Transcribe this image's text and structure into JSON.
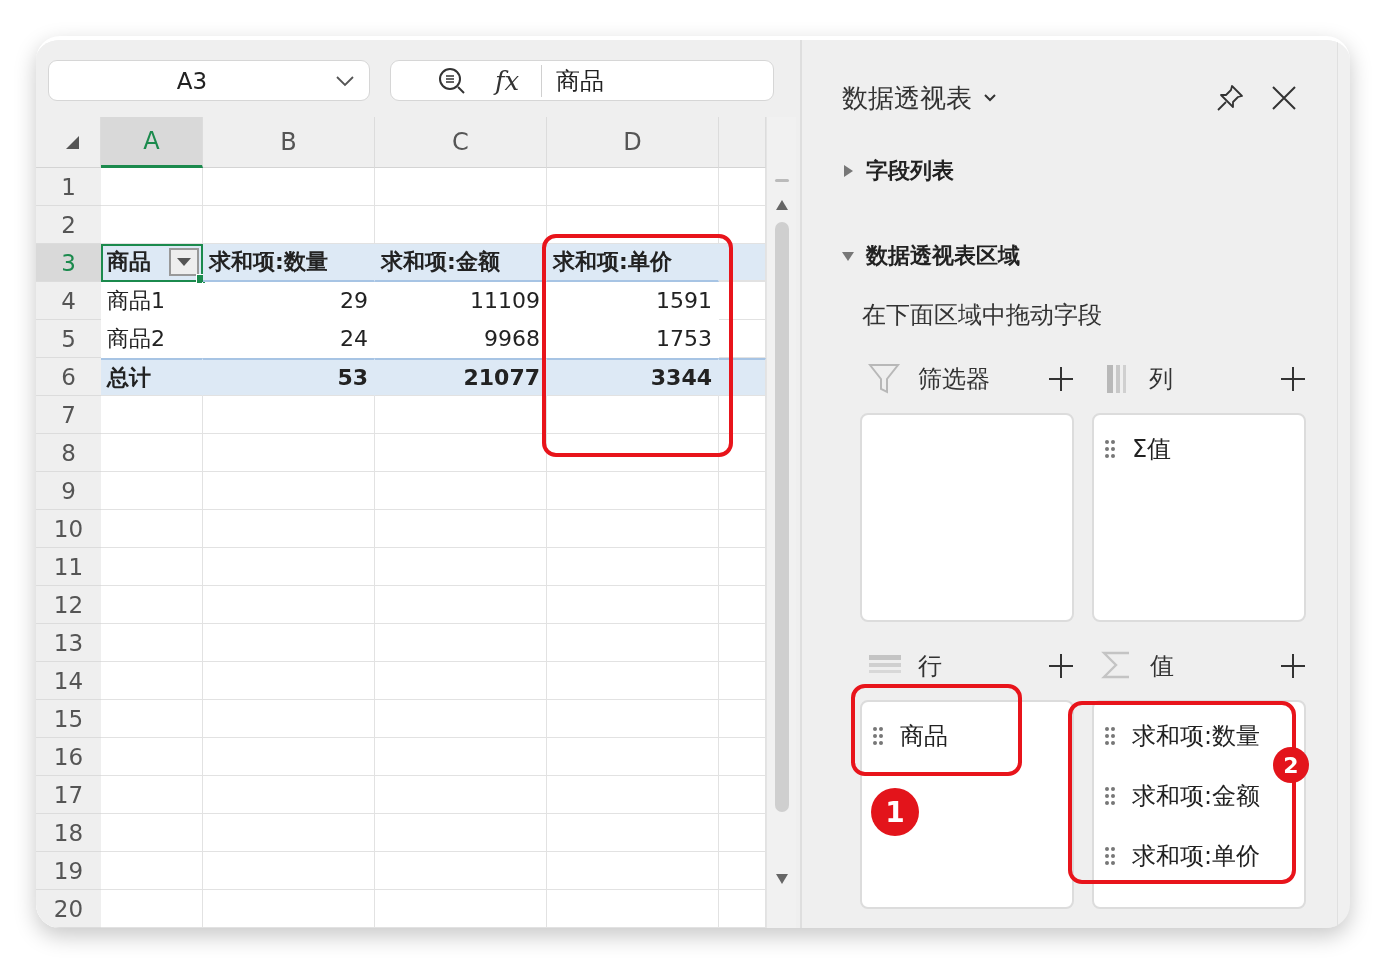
{
  "name_box": {
    "value": "A3"
  },
  "formula_bar": {
    "function_label": "fx",
    "value": "商品"
  },
  "sheet": {
    "columns": [
      {
        "label": "A",
        "selected": true
      },
      {
        "label": "B",
        "selected": false
      },
      {
        "label": "C",
        "selected": false
      },
      {
        "label": "D",
        "selected": false
      }
    ],
    "rows": [
      {
        "header": "1",
        "selected": false
      },
      {
        "header": "2",
        "selected": false
      },
      {
        "header": "3",
        "selected": true,
        "kind": "pivot_header",
        "cells": [
          {
            "text": "商品",
            "selected": true,
            "dropdown": true
          },
          {
            "text": "求和项:数量",
            "selected": false,
            "dropdown": false
          },
          {
            "text": "求和项:金额",
            "selected": false,
            "dropdown": false
          },
          {
            "text": "求和项:单价",
            "selected": false,
            "dropdown": false
          }
        ]
      },
      {
        "header": "4",
        "selected": false,
        "kind": "pivot_item",
        "cells": [
          {
            "text": "商品1",
            "selected": false,
            "dropdown": false
          },
          {
            "text": "29",
            "selected": false,
            "dropdown": false
          },
          {
            "text": "11109",
            "selected": false,
            "dropdown": false
          },
          {
            "text": "1591",
            "selected": false,
            "dropdown": false
          }
        ]
      },
      {
        "header": "5",
        "selected": false,
        "kind": "pivot_item",
        "cells": [
          {
            "text": "商品2",
            "selected": false,
            "dropdown": false
          },
          {
            "text": "24",
            "selected": false,
            "dropdown": false
          },
          {
            "text": "9968",
            "selected": false,
            "dropdown": false
          },
          {
            "text": "1753",
            "selected": false,
            "dropdown": false
          }
        ]
      },
      {
        "header": "6",
        "selected": false,
        "kind": "pivot_total",
        "cells": [
          {
            "text": "总计",
            "selected": false,
            "dropdown": false
          },
          {
            "text": "53",
            "selected": false,
            "dropdown": false
          },
          {
            "text": "21077",
            "selected": false,
            "dropdown": false
          },
          {
            "text": "3344",
            "selected": false,
            "dropdown": false
          }
        ]
      },
      {
        "header": "7",
        "selected": false
      },
      {
        "header": "8",
        "selected": false
      },
      {
        "header": "9",
        "selected": false
      },
      {
        "header": "10",
        "selected": false
      },
      {
        "header": "11",
        "selected": false
      },
      {
        "header": "12",
        "selected": false
      },
      {
        "header": "13",
        "selected": false
      },
      {
        "header": "14",
        "selected": false
      },
      {
        "header": "15",
        "selected": false
      },
      {
        "header": "16",
        "selected": false
      },
      {
        "header": "17",
        "selected": false
      },
      {
        "header": "18",
        "selected": false
      },
      {
        "header": "19",
        "selected": false
      },
      {
        "header": "20",
        "selected": false
      }
    ]
  },
  "panel": {
    "title": "数据透视表",
    "sections": [
      {
        "label": "字段列表",
        "expanded": false
      },
      {
        "label": "数据透视表区域",
        "expanded": true,
        "hint": "在下面区域中拖动字段",
        "areas": [
          {
            "kind": "filter",
            "label": "筛选器"
          },
          {
            "kind": "columns",
            "label": "列",
            "fields": [
              "Σ值"
            ]
          },
          {
            "kind": "rows",
            "label": "行",
            "fields": [
              "商品"
            ]
          },
          {
            "kind": "values",
            "label": "值",
            "fields": [
              "求和项:数量",
              "求和项:金额",
              "求和项:单价"
            ]
          }
        ]
      }
    ]
  },
  "annotations": [
    {
      "kind": "outline"
    },
    {
      "kind": "outline"
    },
    {
      "kind": "outline"
    },
    {
      "kind": "badge",
      "text": "1"
    },
    {
      "kind": "badge",
      "text": "2"
    }
  ]
}
